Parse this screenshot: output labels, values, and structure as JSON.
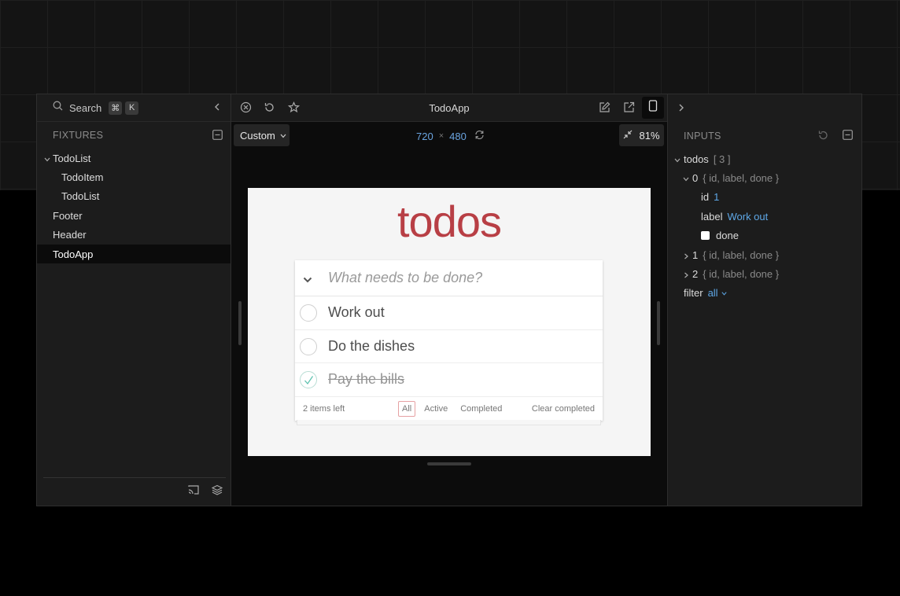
{
  "left": {
    "search_label": "Search",
    "kbd": [
      "⌘",
      "K"
    ],
    "section_title": "FIXTURES",
    "tree": [
      {
        "label": "TodoList",
        "level": 0,
        "expandable": true,
        "selected": false
      },
      {
        "label": "TodoItem",
        "level": 1,
        "expandable": false,
        "selected": false
      },
      {
        "label": "TodoList",
        "level": 1,
        "expandable": false,
        "selected": false
      },
      {
        "label": "Footer",
        "level": 0,
        "expandable": false,
        "selected": false
      },
      {
        "label": "Header",
        "level": 0,
        "expandable": false,
        "selected": false
      },
      {
        "label": "TodoApp",
        "level": 0,
        "expandable": false,
        "selected": true
      }
    ]
  },
  "center": {
    "title": "TodoApp",
    "viewport_preset": "Custom",
    "width": "720",
    "times": "×",
    "height": "480",
    "zoom": "81%"
  },
  "todo_app": {
    "heading": "todos",
    "placeholder": "What needs to be done?",
    "items": [
      {
        "label": "Work out",
        "done": false
      },
      {
        "label": "Do the dishes",
        "done": false
      },
      {
        "label": "Pay the bills",
        "done": true
      }
    ],
    "items_left": "2 items left",
    "filters": [
      "All",
      "Active",
      "Completed"
    ],
    "active_filter": "All",
    "clear_label": "Clear completed",
    "accent": "#b83f45"
  },
  "right": {
    "section_title": "INPUTS",
    "rows": {
      "todos_key": "todos",
      "todos_meta": "[ 3 ]",
      "item0_key": "0",
      "item0_meta": "{ id, label, done }",
      "id_key": "id",
      "id_val": "1",
      "label_key": "label",
      "label_val": "Work out",
      "done_key": "done",
      "item1_key": "1",
      "item1_meta": "{ id, label, done }",
      "item2_key": "2",
      "item2_meta": "{ id, label, done }",
      "filter_key": "filter",
      "filter_val": "all"
    }
  }
}
